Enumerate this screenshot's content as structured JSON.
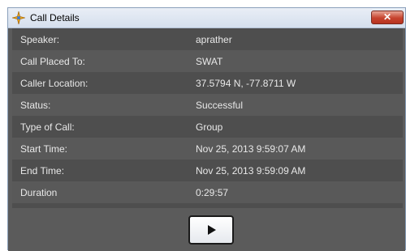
{
  "window": {
    "title": "Call Details",
    "close_label": "✕",
    "icon": "star-compass-icon"
  },
  "details": [
    {
      "label": "Speaker:",
      "value": "aprather"
    },
    {
      "label": "Call Placed To:",
      "value": "SWAT"
    },
    {
      "label": "Caller Location:",
      "value": "37.5794 N, -77.8711 W"
    },
    {
      "label": "Status:",
      "value": "Successful"
    },
    {
      "label": "Type of Call:",
      "value": "Group"
    },
    {
      "label": "Start Time:",
      "value": "Nov 25, 2013 9:59:07 AM"
    },
    {
      "label": "End Time:",
      "value": "Nov 25, 2013 9:59:09 AM"
    },
    {
      "label": "Duration",
      "value": "0:29:57"
    }
  ],
  "footer": {
    "play_icon": "play-icon"
  },
  "colors": {
    "panel_dark": "#4e4e4e",
    "panel_light": "#595959",
    "text": "#e8e8e8",
    "close_red": "#c7432e"
  }
}
